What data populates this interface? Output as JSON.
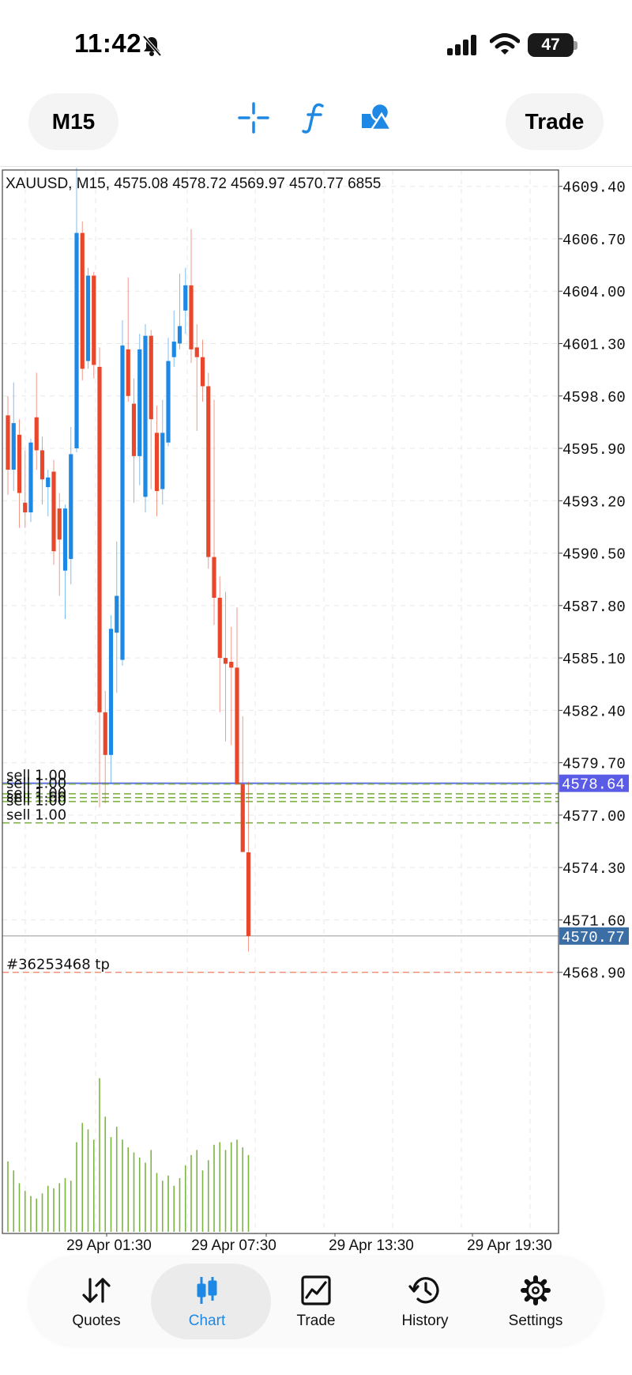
{
  "status_bar": {
    "time": "11:42",
    "battery": "47"
  },
  "toolbar": {
    "timeframe": "M15",
    "trade_label": "Trade",
    "icons": [
      "crosshair-icon",
      "indicator-f-icon",
      "objects-icon"
    ]
  },
  "chart_info": "XAUUSD, M15, 4575.08 4578.72 4569.97 4570.77 6855",
  "colors": {
    "bull": "#1e88e5",
    "bear": "#e8472c",
    "volume": "#7cb342",
    "accent": "#1e88e5"
  },
  "chart_data": {
    "type": "candlestick",
    "symbol": "XAUUSD",
    "timeframe": "M15",
    "ylim": [
      4566.5,
      4612.5
    ],
    "y_ticks": [
      "4609.40",
      "4606.70",
      "4604.00",
      "4601.30",
      "4598.60",
      "4595.90",
      "4593.20",
      "4590.50",
      "4587.80",
      "4585.10",
      "4582.40",
      "4579.70",
      "4577.00",
      "4574.30",
      "4571.60",
      "4568.90"
    ],
    "x_tick_labels": [
      "29 Apr 01:30",
      "29 Apr 07:30",
      "29 Apr 13:30",
      "29 Apr 19:30"
    ],
    "candles": [
      {
        "o": 4597.6,
        "h": 4598.6,
        "l": 4593.5,
        "c": 4594.8
      },
      {
        "o": 4594.8,
        "h": 4599.3,
        "l": 4593.7,
        "c": 4597.2
      },
      {
        "o": 4596.6,
        "h": 4597.4,
        "l": 4591.8,
        "c": 4593.6
      },
      {
        "o": 4593.1,
        "h": 4595.8,
        "l": 4591.8,
        "c": 4592.6
      },
      {
        "o": 4592.6,
        "h": 4596.4,
        "l": 4592.1,
        "c": 4596.2
      },
      {
        "o": 4597.5,
        "h": 4599.8,
        "l": 4594.8,
        "c": 4595.8
      },
      {
        "o": 4595.8,
        "h": 4596.5,
        "l": 4593.0,
        "c": 4594.3
      },
      {
        "o": 4593.9,
        "h": 4594.8,
        "l": 4592.4,
        "c": 4594.4
      },
      {
        "o": 4594.7,
        "h": 4595.3,
        "l": 4589.9,
        "c": 4590.6
      },
      {
        "o": 4592.8,
        "h": 4593.6,
        "l": 4588.3,
        "c": 4591.2
      },
      {
        "o": 4589.6,
        "h": 4593.0,
        "l": 4587.1,
        "c": 4592.8
      },
      {
        "o": 4590.2,
        "h": 4597.0,
        "l": 4588.9,
        "c": 4595.6
      },
      {
        "o": 4595.9,
        "h": 4611.4,
        "l": 4595.7,
        "c": 4607.0
      },
      {
        "o": 4607.0,
        "h": 4607.6,
        "l": 4599.4,
        "c": 4600.0
      },
      {
        "o": 4600.4,
        "h": 4605.2,
        "l": 4600.0,
        "c": 4604.8
      },
      {
        "o": 4604.8,
        "h": 4605.0,
        "l": 4599.5,
        "c": 4600.2
      },
      {
        "o": 4600.1,
        "h": 4601.1,
        "l": 4577.4,
        "c": 4582.3
      },
      {
        "o": 4582.3,
        "h": 4583.4,
        "l": 4577.6,
        "c": 4580.1
      },
      {
        "o": 4580.1,
        "h": 4587.3,
        "l": 4578.6,
        "c": 4586.6
      },
      {
        "o": 4586.4,
        "h": 4591.1,
        "l": 4583.3,
        "c": 4588.3
      },
      {
        "o": 4585.0,
        "h": 4602.5,
        "l": 4584.7,
        "c": 4601.2
      },
      {
        "o": 4601.0,
        "h": 4604.7,
        "l": 4598.3,
        "c": 4598.6
      },
      {
        "o": 4598.2,
        "h": 4599.5,
        "l": 4593.1,
        "c": 4595.5
      },
      {
        "o": 4595.5,
        "h": 4601.8,
        "l": 4594.0,
        "c": 4601.0
      },
      {
        "o": 4593.4,
        "h": 4602.3,
        "l": 4592.6,
        "c": 4601.7
      },
      {
        "o": 4601.7,
        "h": 4602.0,
        "l": 4593.8,
        "c": 4597.4
      },
      {
        "o": 4596.7,
        "h": 4598.1,
        "l": 4592.4,
        "c": 4593.7
      },
      {
        "o": 4593.8,
        "h": 4598.4,
        "l": 4593.0,
        "c": 4596.7
      },
      {
        "o": 4596.2,
        "h": 4601.6,
        "l": 4596.0,
        "c": 4600.4
      },
      {
        "o": 4600.6,
        "h": 4603.0,
        "l": 4600.1,
        "c": 4601.4
      },
      {
        "o": 4601.3,
        "h": 4604.9,
        "l": 4601.0,
        "c": 4602.2
      },
      {
        "o": 4603.0,
        "h": 4605.2,
        "l": 4601.8,
        "c": 4604.3
      },
      {
        "o": 4604.3,
        "h": 4607.2,
        "l": 4600.3,
        "c": 4601.0
      },
      {
        "o": 4601.1,
        "h": 4602.3,
        "l": 4596.8,
        "c": 4600.6
      },
      {
        "o": 4600.6,
        "h": 4601.5,
        "l": 4598.3,
        "c": 4599.1
      },
      {
        "o": 4599.1,
        "h": 4599.8,
        "l": 4589.7,
        "c": 4590.3
      },
      {
        "o": 4590.3,
        "h": 4598.4,
        "l": 4586.8,
        "c": 4588.2
      },
      {
        "o": 4588.2,
        "h": 4589.3,
        "l": 4582.3,
        "c": 4585.1
      },
      {
        "o": 4585.1,
        "h": 4588.5,
        "l": 4580.8,
        "c": 4584.8
      },
      {
        "o": 4584.9,
        "h": 4586.7,
        "l": 4580.6,
        "c": 4584.6
      },
      {
        "o": 4584.6,
        "h": 4587.7,
        "l": 4578.8,
        "c": 4578.6
      },
      {
        "o": 4578.6,
        "h": 4582.1,
        "l": 4575.1,
        "c": 4575.1
      },
      {
        "o": 4575.08,
        "h": 4578.72,
        "l": 4569.97,
        "c": 4570.77
      }
    ],
    "volume": [
      55,
      48,
      38,
      32,
      28,
      26,
      30,
      36,
      34,
      38,
      42,
      40,
      70,
      85,
      80,
      72,
      120,
      90,
      74,
      82,
      72,
      66,
      62,
      58,
      54,
      64,
      46,
      40,
      44,
      36,
      42,
      52,
      60,
      64,
      48,
      56,
      68,
      70,
      64,
      70,
      72,
      66,
      60
    ],
    "levels": [
      {
        "label": "sell 1.00",
        "price": 4578.64,
        "style": "solid",
        "color": "#5b6ee1"
      },
      {
        "label": "sell 1.00",
        "price": 4578.6,
        "style": "dashed",
        "color": "#7cb342"
      },
      {
        "label": "sell 1.00",
        "price": 4578.1,
        "style": "dashed",
        "color": "#7cb342"
      },
      {
        "label": "sell 1.00",
        "price": 4577.9,
        "style": "dashed",
        "color": "#7cb342"
      },
      {
        "label": "sell 1.00",
        "price": 4577.7,
        "style": "dashed",
        "color": "#7cb342"
      },
      {
        "label": "sell 1.00",
        "price": 4576.6,
        "style": "dashed",
        "color": "#7cb342"
      }
    ],
    "tp_label": "#36253468 tp",
    "tp_price": 4568.9,
    "ask_label": "4578.64",
    "ask_price": 4578.64,
    "bid_label": "4570.77",
    "bid_price": 4570.77
  },
  "tabs": [
    {
      "label": "Quotes",
      "icon": "quotes-arrows-icon"
    },
    {
      "label": "Chart",
      "icon": "chart-candles-icon"
    },
    {
      "label": "Trade",
      "icon": "trade-chart-icon"
    },
    {
      "label": "History",
      "icon": "history-clock-icon"
    },
    {
      "label": "Settings",
      "icon": "settings-gear-icon"
    }
  ]
}
